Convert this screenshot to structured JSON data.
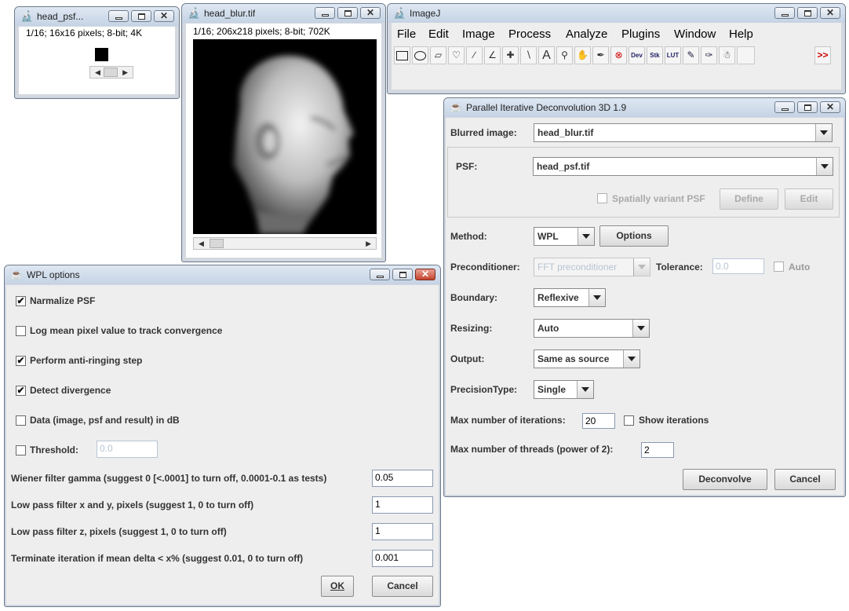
{
  "psf_window": {
    "title": "head_psf...",
    "info": "1/16; 16x16 pixels; 8-bit; 4K"
  },
  "blur_window": {
    "title": "head_blur.tif",
    "info": "1/16; 206x218 pixels; 8-bit; 702K"
  },
  "imagej": {
    "title": "ImageJ",
    "menu": [
      "File",
      "Edit",
      "Image",
      "Process",
      "Analyze",
      "Plugins",
      "Window",
      "Help"
    ],
    "tools": [
      "rectangle-tool-icon",
      "oval-tool-icon",
      "polygon-tool-icon",
      "freehand-tool-icon",
      "line-tool-icon",
      "angle-tool-icon",
      "point-tool-icon",
      "wand-tool-icon",
      "text-tool-icon",
      "magnifier-tool-icon",
      "hand-tool-icon",
      "color-picker-tool-icon",
      "macro-tool-icon",
      "dev-tool-icon",
      "stk-tool-icon",
      "lut-tool-icon",
      "pencil-tool-icon",
      "brush-tool-icon",
      "flood-fill-tool-icon"
    ],
    "tool_glyphs": {
      "text": "A",
      "dev": "Dev",
      "stk": "Stk",
      "lut": "LUT",
      "more": ">>"
    }
  },
  "pid": {
    "title": "Parallel Iterative Deconvolution 3D 1.9",
    "blurred_label": "Blurred image:",
    "blurred_value": "head_blur.tif",
    "psf_label": "PSF:",
    "psf_value": "head_psf.tif",
    "spatially_variant_label": "Spatially variant PSF",
    "define_label": "Define",
    "edit_label": "Edit",
    "method_label": "Method:",
    "method_value": "WPL",
    "options_label": "Options",
    "preconditioner_label": "Preconditioner:",
    "preconditioner_value": "FFT preconditioner",
    "tolerance_label": "Tolerance:",
    "tolerance_value": "0.0",
    "auto_label": "Auto",
    "boundary_label": "Boundary:",
    "boundary_value": "Reflexive",
    "resizing_label": "Resizing:",
    "resizing_value": "Auto",
    "output_label": "Output:",
    "output_value": "Same as source",
    "precision_label": "PrecisionType:",
    "precision_value": "Single",
    "max_iter_label": "Max number of iterations:",
    "max_iter_value": "20",
    "show_iter_label": "Show iterations",
    "max_threads_label": "Max number of threads (power of 2):",
    "max_threads_value": "2",
    "deconvolve_label": "Deconvolve",
    "cancel_label": "Cancel"
  },
  "wpl": {
    "title": "WPL options",
    "checks": [
      {
        "label": "Narmalize PSF",
        "checked": true
      },
      {
        "label": "Log mean pixel value to track convergence",
        "checked": false
      },
      {
        "label": "Perform anti-ringing step",
        "checked": true
      },
      {
        "label": "Detect divergence",
        "checked": true
      },
      {
        "label": "Data (image, psf and result) in dB",
        "checked": false
      }
    ],
    "threshold_label": "Threshold:",
    "threshold_value": "0.0",
    "params": [
      {
        "label": "Wiener filter gamma (suggest 0 [<.0001] to turn off, 0.0001-0.1 as tests)",
        "value": "0.05"
      },
      {
        "label": "Low pass filter x and y, pixels (suggest 1, 0 to turn off)",
        "value": "1"
      },
      {
        "label": "Low pass filter z, pixels (suggest 1, 0 to turn off)",
        "value": "1"
      },
      {
        "label": "Terminate iteration if mean delta < x% (suggest 0.01, 0 to turn off)",
        "value": "0.001"
      }
    ],
    "ok_label": "OK",
    "cancel_label": "Cancel"
  },
  "colors": {
    "titlebar": "#c5d3e4",
    "panel": "#eeeeee",
    "close_red": "#c4432c",
    "disabled_text": "#b8c4d2"
  }
}
